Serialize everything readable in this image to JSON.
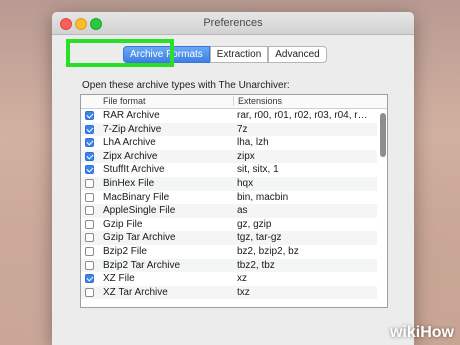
{
  "window": {
    "title": "Preferences"
  },
  "tabs": [
    {
      "label": "Archive Formats",
      "active": true
    },
    {
      "label": "Extraction",
      "active": false
    },
    {
      "label": "Advanced",
      "active": false
    }
  ],
  "description": "Open these archive types with The Unarchiver:",
  "table": {
    "columns": [
      "File format",
      "Extensions"
    ],
    "rows": [
      {
        "checked": true,
        "format": "RAR Archive",
        "ext": "rar, r00, r01, r02, r03, r04, r…"
      },
      {
        "checked": true,
        "format": "7-Zip Archive",
        "ext": "7z"
      },
      {
        "checked": true,
        "format": "LhA Archive",
        "ext": "lha, lzh"
      },
      {
        "checked": true,
        "format": "Zipx Archive",
        "ext": "zipx"
      },
      {
        "checked": true,
        "format": "StuffIt Archive",
        "ext": "sit, sitx, 1"
      },
      {
        "checked": false,
        "format": "BinHex File",
        "ext": "hqx"
      },
      {
        "checked": false,
        "format": "MacBinary File",
        "ext": "bin, macbin"
      },
      {
        "checked": false,
        "format": "AppleSingle File",
        "ext": "as"
      },
      {
        "checked": false,
        "format": "Gzip File",
        "ext": "gz, gzip"
      },
      {
        "checked": false,
        "format": "Gzip Tar Archive",
        "ext": "tgz, tar-gz"
      },
      {
        "checked": false,
        "format": "Bzip2 File",
        "ext": "bz2, bzip2, bz"
      },
      {
        "checked": false,
        "format": "Bzip2 Tar Archive",
        "ext": "tbz2, tbz"
      },
      {
        "checked": true,
        "format": "XZ File",
        "ext": "xz"
      },
      {
        "checked": false,
        "format": "XZ Tar Archive",
        "ext": "txz"
      }
    ]
  },
  "watermark": {
    "wiki": "wiki",
    "how": "How"
  }
}
